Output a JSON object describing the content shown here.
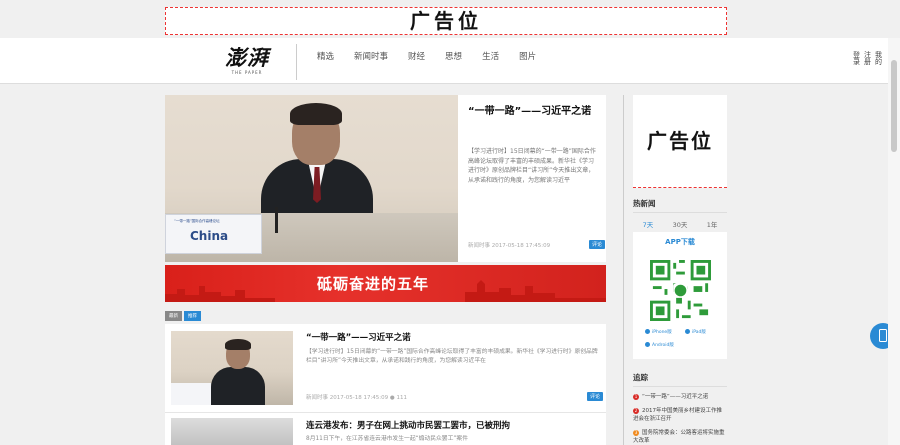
{
  "top_ad": {
    "text": "广告位"
  },
  "header": {
    "logo_main": "澎湃",
    "logo_sub": "THE PAPER",
    "nav": [
      "精选",
      "新闻时事",
      "财经",
      "思想",
      "生活",
      "图片"
    ],
    "user_links": [
      "登录",
      "注册",
      "我的"
    ]
  },
  "hero": {
    "title": "“一带一路”——习近平之诺",
    "summary": "【学习进行时】15日闭幕的“一带一路”国际合作高峰论坛取得了丰富的丰硕成果。新华社《学习进行时》原创品牌栏目“讲习所”今天推出文章，从承诺和践行的角度，为您解读习近平",
    "nameplate": "China",
    "nameplate_small": "“一带一路”国际合作高峰论坛",
    "meta": "新闻时事  2017-05-18 17:45:09",
    "badge": "评论"
  },
  "banner": {
    "text": "砥砺奋进的五年"
  },
  "list_tabs": [
    "最新",
    "推荐"
  ],
  "list": [
    {
      "title": "“一带一路”——习近平之诺",
      "summary": "【学习进行时】15日闭幕的“一带一路”国际合作高峰论坛取得了丰富的丰硕成果。新华社《学习进行时》原创品牌栏目“讲习所”今天推出文章，从承诺和践行的角度，为您解读习近平在",
      "meta": "新闻时事  2017-05-18 17:45:09  ● 111",
      "badge": "评论"
    },
    {
      "title": "连云港发布：男子在网上挑动市民罢工罢市，已被刑拘",
      "summary": "8月11日下午，在江苏省连云港市发生一起“煽动民众罢工”案件",
      "meta": "",
      "badge": ""
    }
  ],
  "sidebar": {
    "ad_text": "广告位",
    "hot_title": "热新闻",
    "hot_tabs": [
      "7天",
      "30天",
      "1年"
    ],
    "app_title": "APP下载",
    "app_links": [
      "iPhone版",
      "iPad版",
      "Android版"
    ],
    "rank_title": "追踪",
    "rank_items": [
      "“一带一路”——习近平之诺",
      "2017年中国美丽乡村建设工作推进会在浙江召开",
      "国务院常委会：公路客运将实施重大改革"
    ]
  },
  "colors": {
    "accent": "#2a8ad4",
    "banner_red": "#d9201a",
    "ad_border": "#e33333"
  }
}
